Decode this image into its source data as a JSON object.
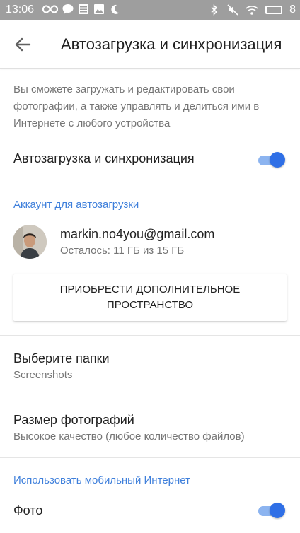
{
  "status_bar": {
    "time": "13:06",
    "battery_level": "8",
    "left_icons": [
      "infinity-icon",
      "chat-icon",
      "list-icon",
      "image-icon",
      "moon-icon"
    ],
    "right_icons": [
      "bluetooth-icon",
      "mute-icon",
      "wifi-icon",
      "battery-icon"
    ]
  },
  "toolbar": {
    "title": "Автозагрузка и синхронизация",
    "back_icon": "arrow-back-icon"
  },
  "description": "Вы сможете загружать и редактировать свои фотографии, а также управлять и делиться ими в Интернете с любого устройства",
  "sync_toggle": {
    "label": "Автозагрузка и синхронизация",
    "on": true
  },
  "account_section": {
    "header": "Аккаунт для автозагрузки",
    "email": "markin.no4you@gmail.com",
    "quota": "Осталось: 11 ГБ из 15 ГБ",
    "buy_button": "ПРИОБРЕСТИ ДОПОЛНИТЕЛЬНОЕ ПРОСТРАНСТВО"
  },
  "folders": {
    "title": "Выберите папки",
    "value": "Screenshots"
  },
  "photo_size": {
    "title": "Размер фотографий",
    "value": "Высокое качество (любое количество файлов)"
  },
  "mobile_section": {
    "header": "Использовать мобильный Интернет",
    "photo_toggle": {
      "label": "Фото",
      "on": true
    }
  },
  "colors": {
    "accent": "#2f6fe6",
    "section_header": "#3e7fdb",
    "status_bar": "#9e9e9e"
  }
}
